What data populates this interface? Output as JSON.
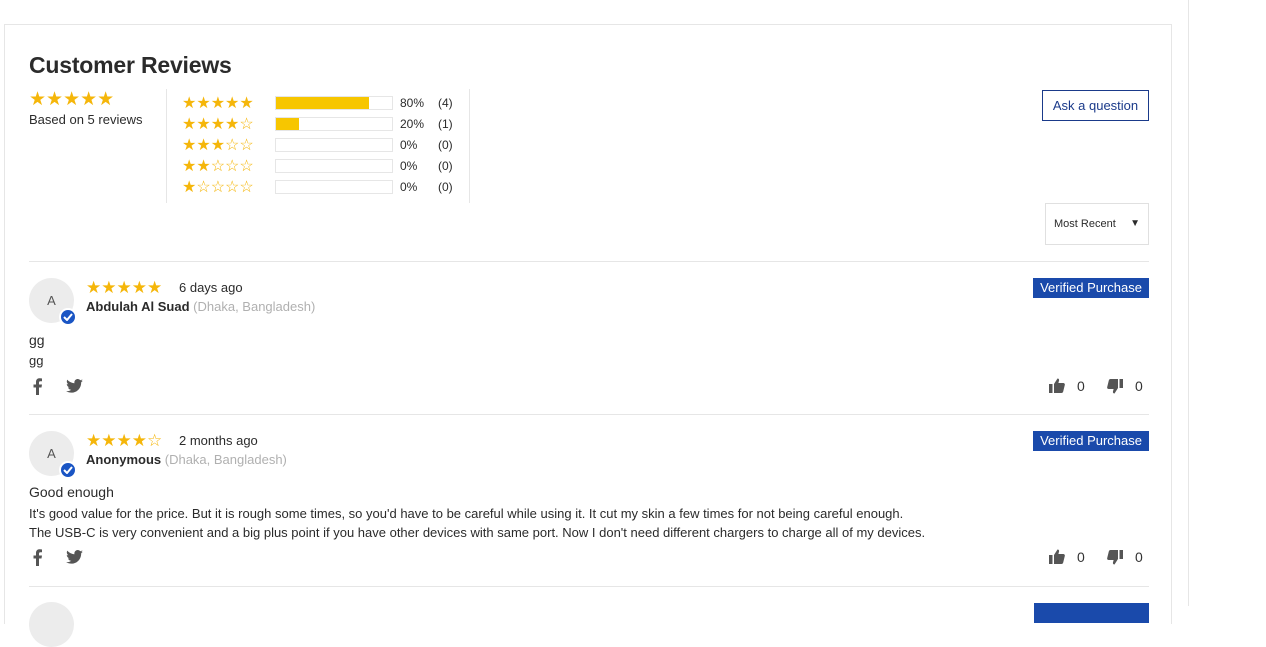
{
  "header": {
    "title": "Customer Reviews"
  },
  "summary": {
    "rating": 5,
    "based_on": "Based on 5 reviews"
  },
  "histogram": [
    {
      "stars": 5,
      "fraction": 0.8,
      "pct": "80%",
      "count": "(4)"
    },
    {
      "stars": 4,
      "fraction": 0.2,
      "pct": "20%",
      "count": "(1)"
    },
    {
      "stars": 3,
      "fraction": 0,
      "pct": "0%",
      "count": "(0)"
    },
    {
      "stars": 2,
      "fraction": 0,
      "pct": "0%",
      "count": "(0)"
    },
    {
      "stars": 1,
      "fraction": 0,
      "pct": "0%",
      "count": "(0)"
    }
  ],
  "actions": {
    "ask_label": "Ask a question"
  },
  "sort": {
    "selected": "Most Recent"
  },
  "reviews": [
    {
      "avatar_initial": "A",
      "rating": 5,
      "date": "6 days ago",
      "name": "Abdulah Al Suad",
      "location": "(Dhaka, Bangladesh)",
      "badge": "Verified Purchase",
      "title": "gg",
      "body": [
        "gg"
      ],
      "likes": "0",
      "dislikes": "0"
    },
    {
      "avatar_initial": "A",
      "rating": 4,
      "date": "2 months ago",
      "name": "Anonymous",
      "location": "(Dhaka, Bangladesh)",
      "badge": "Verified Purchase",
      "title": "Good enough",
      "body": [
        "It's good value for the price. But it is rough some times, so you'd have to be careful while using it. It cut my skin a few times for not being careful enough.",
        "The USB-C is very convenient and a big plus point if you have other devices with same port. Now I don't need different chargers to charge all of my devices."
      ],
      "likes": "0",
      "dislikes": "0"
    }
  ],
  "colors": {
    "star": "#f5b60a",
    "bar_fill": "#f7c600",
    "badge": "#1a4aab",
    "ask_border": "#1a3a8a"
  },
  "icons": [
    "facebook-icon",
    "twitter-icon",
    "thumbs-up-icon",
    "thumbs-down-icon",
    "check-icon",
    "caret-down-icon"
  ]
}
